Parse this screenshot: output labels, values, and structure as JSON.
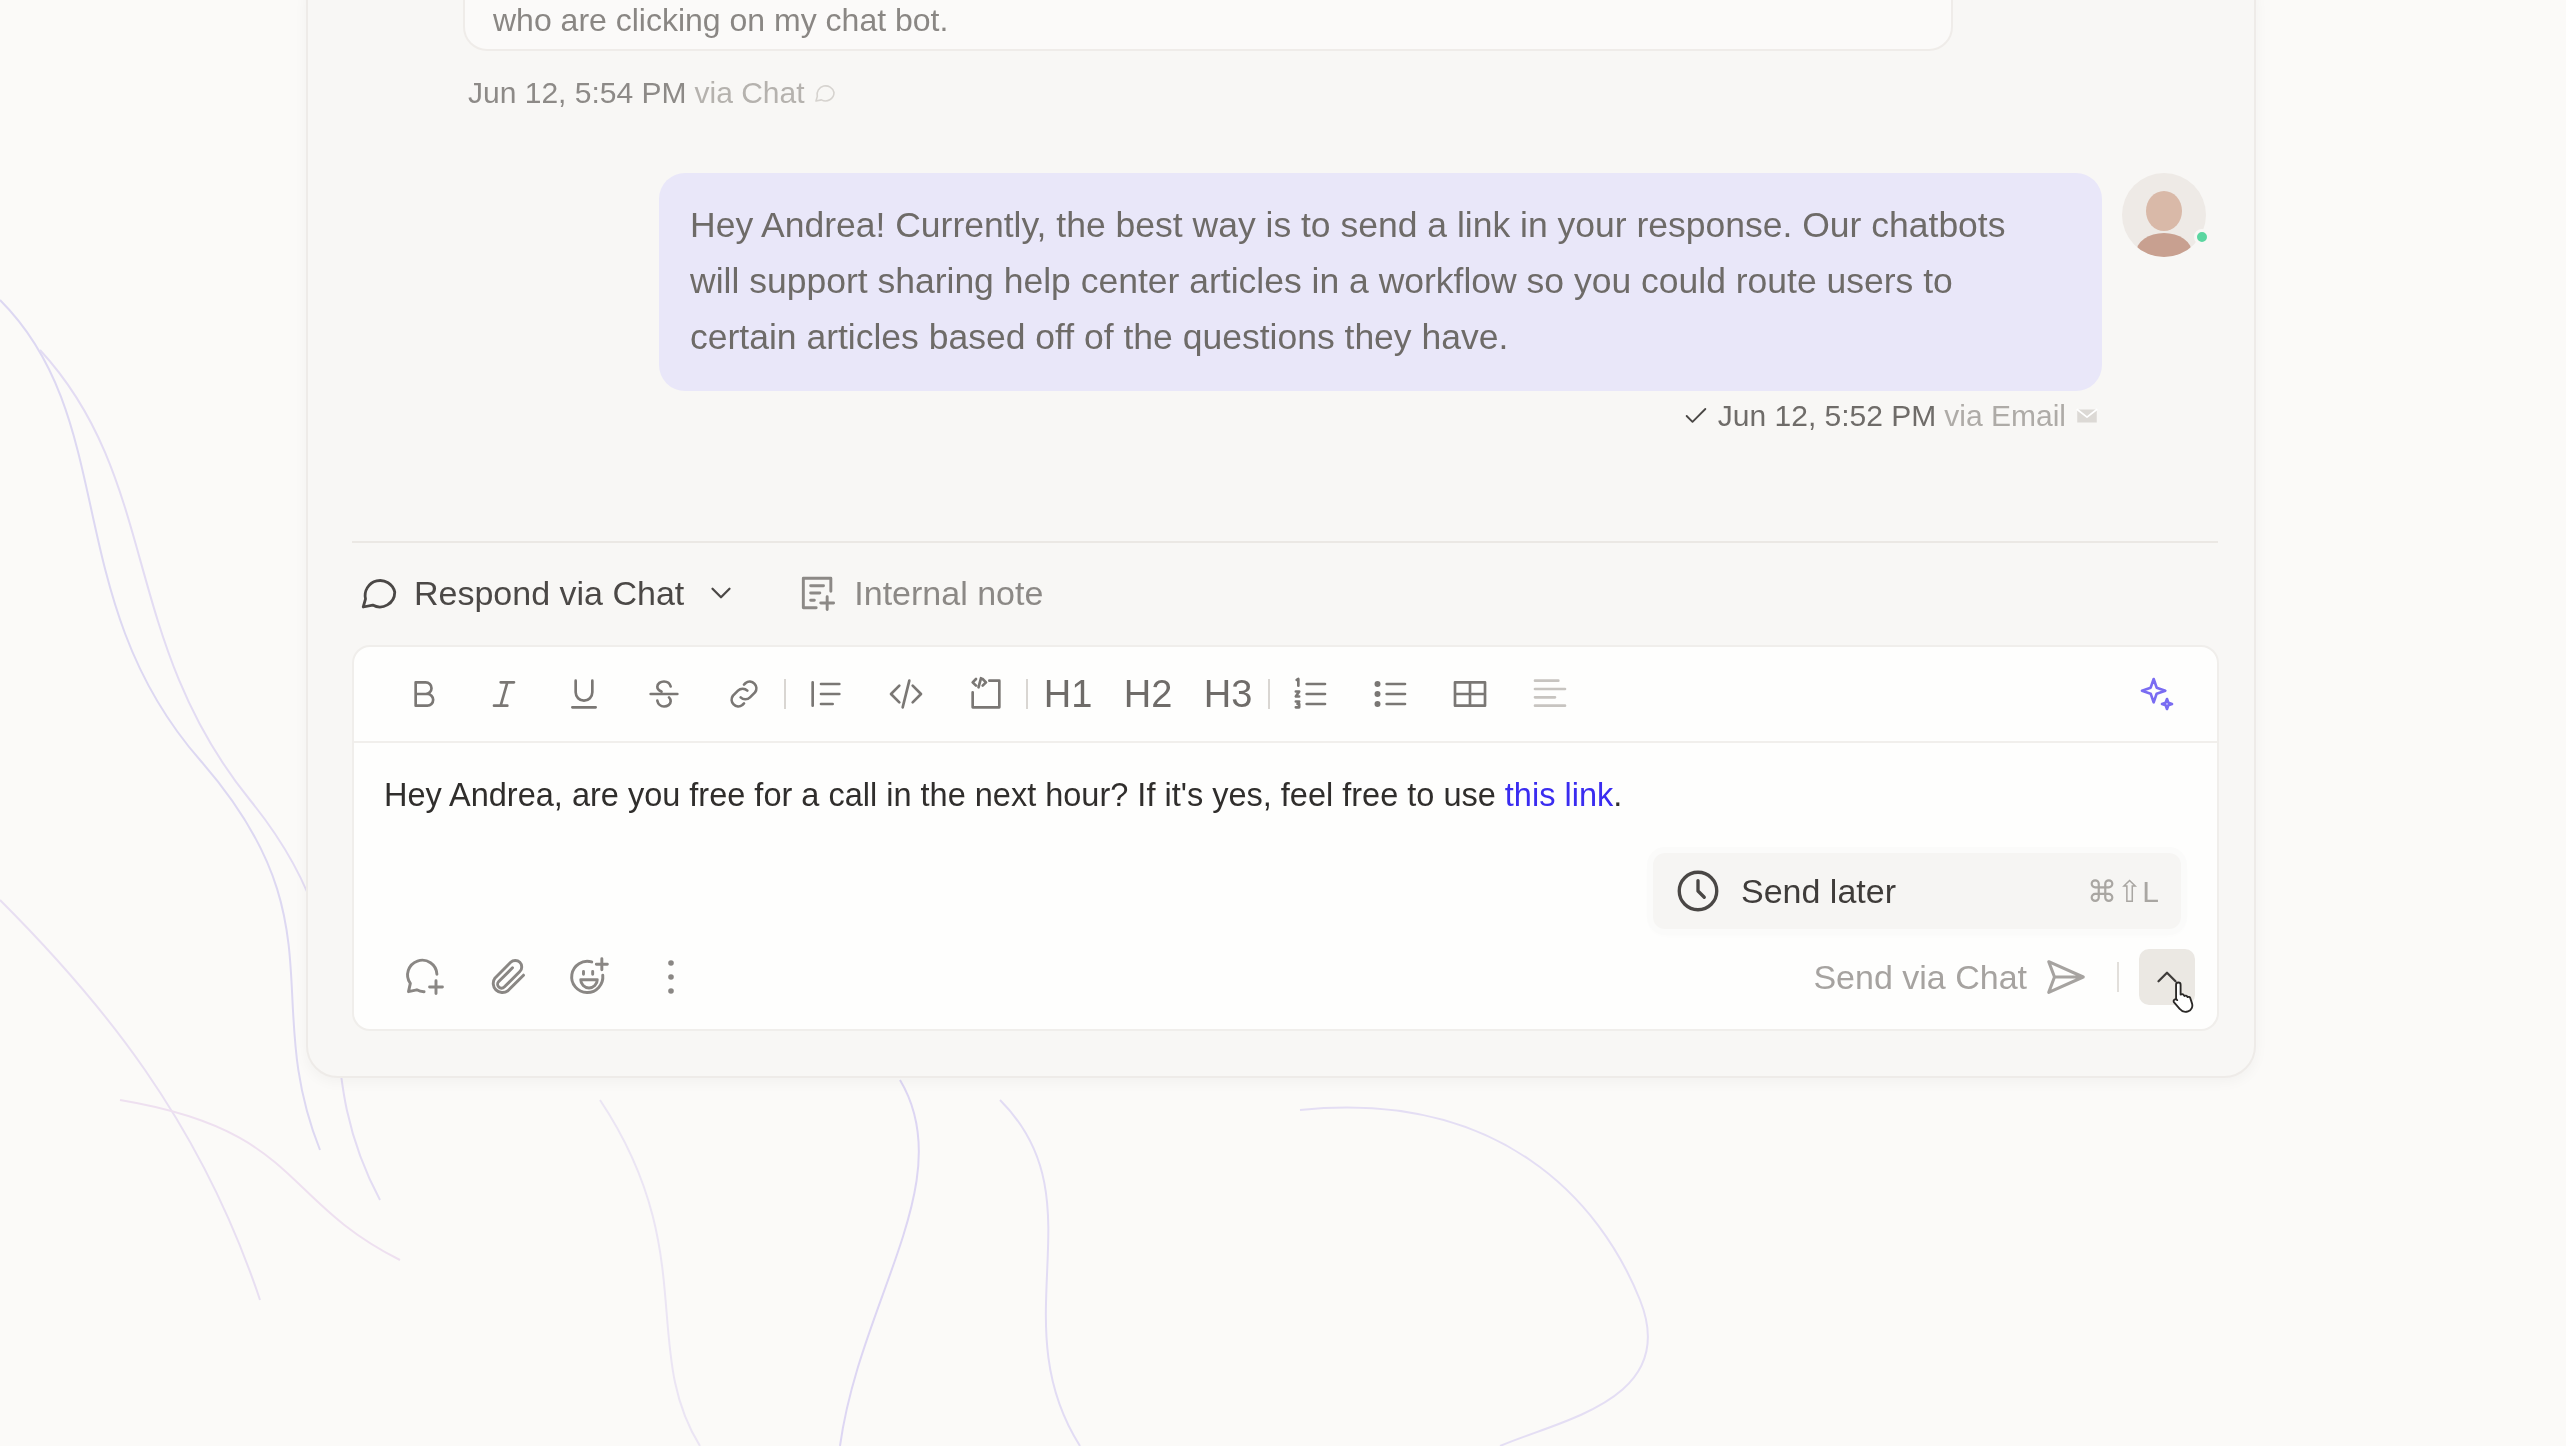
{
  "previous_message": {
    "text": "who are clicking on my chat bot.",
    "time": "Jun 12, 5:54 PM",
    "channel": "via Chat"
  },
  "reply_message": {
    "text": "Hey Andrea! Currently, the best way is to send a link in your response. Our chatbots will support sharing help center articles in a workflow so you could route users to certain articles based off of the questions they have.",
    "delivered": true,
    "time": "Jun 12, 5:52 PM",
    "channel": "via Email",
    "author_online": true
  },
  "composer": {
    "modes": [
      {
        "label": "Respond via Chat",
        "kind": "dropdown",
        "selected": true
      },
      {
        "label": "Internal note",
        "kind": "note",
        "selected": false
      }
    ],
    "toolbar": [
      {
        "kind": "bold"
      },
      {
        "kind": "italic"
      },
      {
        "kind": "underline"
      },
      {
        "kind": "strike"
      },
      {
        "kind": "link"
      },
      {
        "kind": "separator"
      },
      {
        "kind": "quote"
      },
      {
        "kind": "code"
      },
      {
        "kind": "codeblock"
      },
      {
        "kind": "separator"
      },
      {
        "kind": "heading",
        "label": "H1"
      },
      {
        "kind": "heading",
        "label": "H2"
      },
      {
        "kind": "heading",
        "label": "H3"
      },
      {
        "kind": "separator"
      },
      {
        "kind": "ordered-list"
      },
      {
        "kind": "bullet-list"
      },
      {
        "kind": "table"
      },
      {
        "kind": "align",
        "disabled": true
      },
      {
        "kind": "ai"
      }
    ],
    "draft": {
      "text": "Hey Andrea, are you free for a call in the next hour? If it's yes, feel free to use ",
      "link": "this link",
      "after": "."
    },
    "send_later": {
      "label": "Send later",
      "shortcut": "⌘⇧L"
    },
    "actions": [
      {
        "kind": "mention"
      },
      {
        "kind": "attach"
      },
      {
        "kind": "emoji"
      },
      {
        "kind": "more"
      }
    ],
    "send_button": {
      "label": "Send via Chat"
    }
  }
}
